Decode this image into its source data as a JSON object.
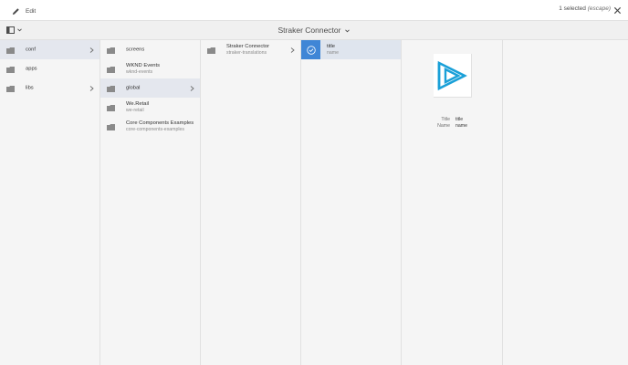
{
  "toolbar": {
    "edit_label": "Edit",
    "selected_count": "1 selected",
    "selected_hint": "(escape)"
  },
  "subheader": {
    "title": "Straker Connector"
  },
  "columns": {
    "col1": [
      {
        "label": "conf",
        "has_children": true,
        "active": true
      },
      {
        "label": "apps",
        "has_children": false,
        "active": false
      },
      {
        "label": "libs",
        "has_children": true,
        "active": false
      }
    ],
    "col2": [
      {
        "label": "screens",
        "sub": ""
      },
      {
        "label": "WKND Events",
        "sub": "wknd-events"
      },
      {
        "label": "global",
        "sub": "",
        "has_children": true,
        "active": true
      },
      {
        "label": "We.Retail",
        "sub": "we-retail"
      },
      {
        "label": "Core Components Examples",
        "sub": "core-components-examples"
      }
    ],
    "col3": [
      {
        "label": "Straker Connector",
        "sub": "straker-translations",
        "has_children": true
      }
    ],
    "col4": [
      {
        "label": "title",
        "sub": "name",
        "selected": true
      }
    ]
  },
  "preview": {
    "fields": [
      {
        "key": "Title",
        "value": "title"
      },
      {
        "key": "Name",
        "value": "name"
      }
    ]
  },
  "colors": {
    "accent": "#3f86d6",
    "logo": "#1aa0d8",
    "selected_row": "#dfe5ee",
    "active_row": "#e4e7ee"
  }
}
